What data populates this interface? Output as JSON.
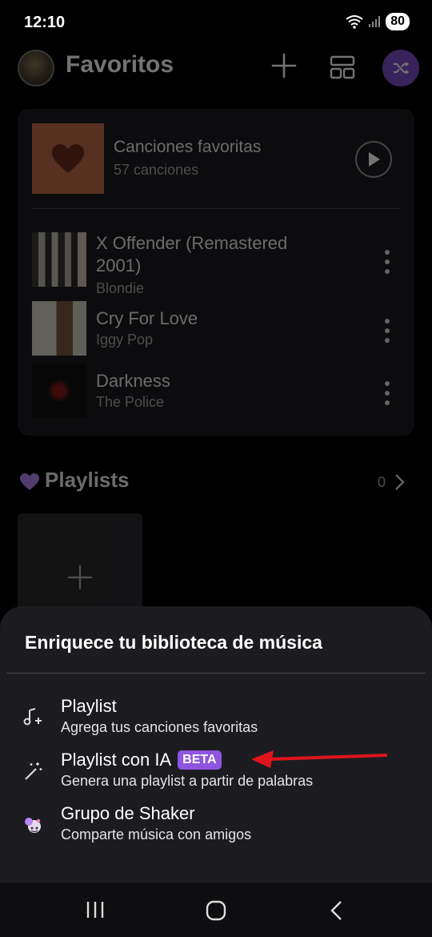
{
  "status_bar": {
    "time": "12:10",
    "battery": "80"
  },
  "header": {
    "title": "Favoritos"
  },
  "favorites": {
    "title": "Canciones favoritas",
    "count": "57 canciones"
  },
  "songs": [
    {
      "title": "X Offender (Remastered 2001)",
      "artist": "Blondie"
    },
    {
      "title": "Cry For Love",
      "artist": "Iggy Pop"
    },
    {
      "title": "Darkness",
      "artist": "The Police"
    }
  ],
  "playlists": {
    "title": "Playlists",
    "count": "0"
  },
  "sheet": {
    "title": "Enriquece tu biblioteca de música",
    "options": [
      {
        "title": "Playlist",
        "subtitle": "Agrega tus canciones favoritas",
        "icon": "music-note-plus-icon"
      },
      {
        "title": "Playlist con IA",
        "badge": "BETA",
        "subtitle": "Genera una playlist a partir de palabras",
        "icon": "magic-wand-icon"
      },
      {
        "title": "Grupo de Shaker",
        "subtitle": "Comparte música con amigos",
        "icon": "shaker-group-icon"
      }
    ]
  },
  "colors": {
    "accent": "#8d55e0",
    "annotation_arrow": "#e0141b",
    "favorites_cover": "#c36a4d"
  }
}
